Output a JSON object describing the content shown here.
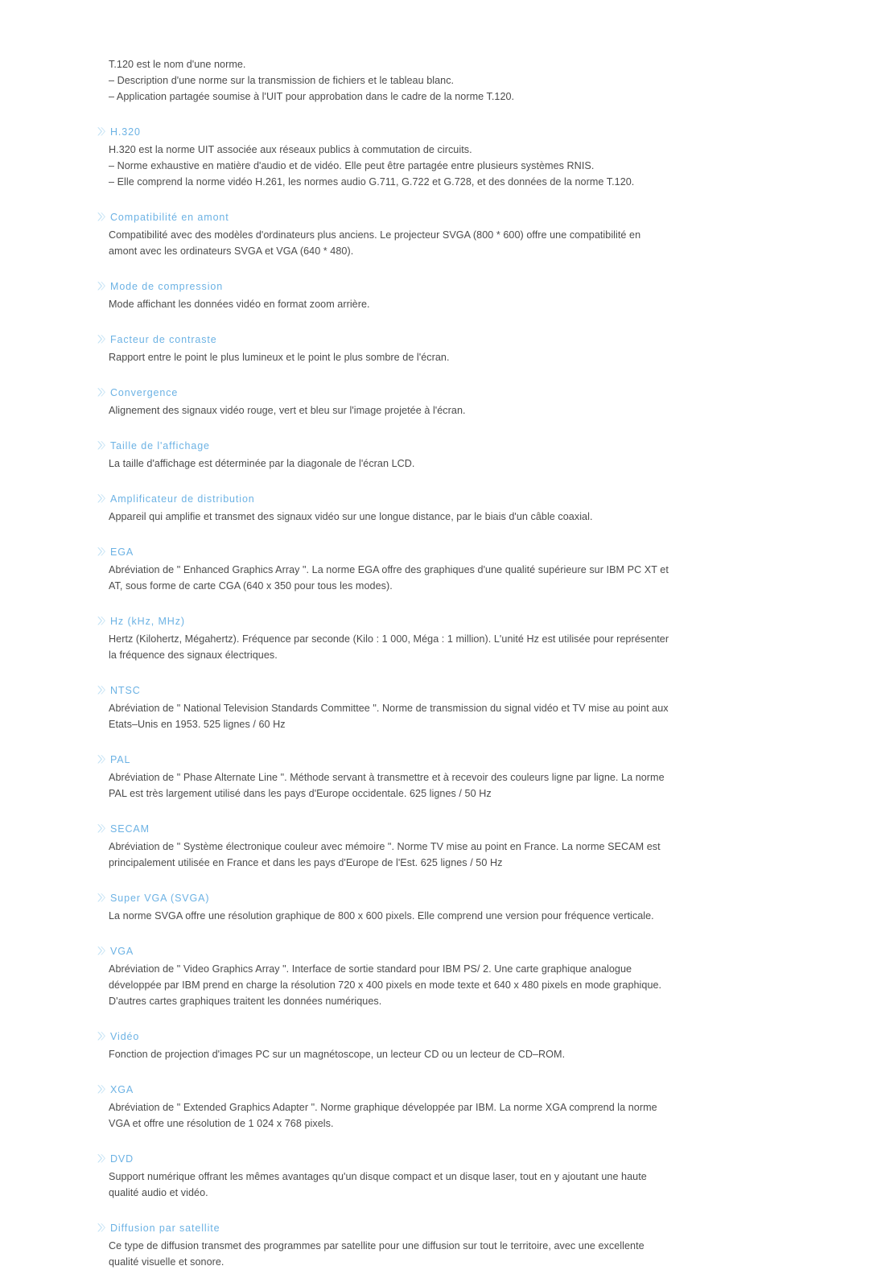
{
  "document": {
    "language": "fr",
    "background_color": "#ffffff",
    "heading_color": "#6cb2e4",
    "body_color": "#4b4b4b",
    "marker_color": "#bddff3",
    "marker_icon": "double-chevron-right-icon"
  },
  "intro": {
    "lines": [
      "T.120 est le nom d'une norme.",
      "– Description d'une norme sur la transmission de fichiers et le tableau blanc.",
      "– Application partagée soumise à l'UIT pour approbation dans le cadre de la norme T.120."
    ]
  },
  "sections": [
    {
      "heading": "H.320",
      "lines": [
        "H.320 est la norme UIT associée aux réseaux publics à commutation de circuits.",
        "– Norme exhaustive en matière d'audio et de vidéo. Elle peut être partagée entre plusieurs systèmes RNIS.",
        "– Elle comprend la norme vidéo H.261, les normes audio G.711, G.722 et G.728, et des données de la norme T.120."
      ]
    },
    {
      "heading": "Compatibilité en amont",
      "lines": [
        "Compatibilité avec des modèles d'ordinateurs plus anciens. Le projecteur SVGA (800 * 600) offre une compatibilité en amont avec les ordinateurs SVGA et VGA (640 * 480)."
      ]
    },
    {
      "heading": "Mode de compression",
      "lines": [
        "Mode affichant les données vidéo en format zoom arrière."
      ]
    },
    {
      "heading": "Facteur de contraste",
      "lines": [
        "Rapport entre le point le plus lumineux et le point le plus sombre de l'écran."
      ]
    },
    {
      "heading": "Convergence",
      "lines": [
        "Alignement des signaux vidéo rouge, vert et bleu sur l'image projetée à l'écran."
      ]
    },
    {
      "heading": "Taille de l'affichage",
      "lines": [
        "La taille d'affichage est déterminée par la diagonale de l'écran LCD."
      ]
    },
    {
      "heading": "Amplificateur de distribution",
      "lines": [
        "Appareil qui amplifie et transmet des signaux vidéo sur une longue distance, par le biais d'un câble coaxial."
      ]
    },
    {
      "heading": "EGA",
      "lines": [
        "Abréviation de \" Enhanced Graphics Array \". La norme EGA offre des graphiques d'une qualité supérieure sur IBM PC XT et AT, sous forme de carte CGA (640 x 350 pour tous les modes)."
      ]
    },
    {
      "heading": "Hz (kHz, MHz)",
      "lines": [
        "Hertz (Kilohertz, Mégahertz). Fréquence par seconde (Kilo : 1 000, Méga : 1 million). L'unité Hz est utilisée pour représenter la fréquence des signaux électriques."
      ]
    },
    {
      "heading": "NTSC",
      "lines": [
        "Abréviation de \" National Television Standards Committee \". Norme de transmission du signal vidéo et TV mise au point aux Etats–Unis en 1953. 525 lignes / 60 Hz"
      ]
    },
    {
      "heading": "PAL",
      "lines": [
        "Abréviation de \" Phase Alternate Line \". Méthode servant à transmettre et à recevoir des couleurs ligne par ligne. La norme PAL est très largement utilisé dans les pays d'Europe occidentale. 625 lignes / 50 Hz"
      ]
    },
    {
      "heading": "SECAM",
      "lines": [
        "Abréviation de \" Système électronique couleur avec mémoire \". Norme TV mise au point en France. La norme SECAM est principalement utilisée en France et dans les pays d'Europe de l'Est. 625 lignes / 50 Hz"
      ]
    },
    {
      "heading": "Super VGA (SVGA)",
      "lines": [
        "La norme SVGA offre une résolution graphique de 800 x 600 pixels. Elle comprend une version pour fréquence verticale."
      ]
    },
    {
      "heading": "VGA",
      "lines": [
        "Abréviation de \" Video Graphics Array \". Interface de sortie standard pour IBM PS/ 2. Une carte graphique analogue développée par IBM prend en charge la résolution 720 x 400 pixels en mode texte et 640 x 480 pixels en mode graphique. D'autres cartes graphiques traitent les données numériques."
      ]
    },
    {
      "heading": "Vidéo",
      "lines": [
        "Fonction de projection d'images PC sur un magnétoscope, un lecteur CD ou un lecteur de CD–ROM."
      ]
    },
    {
      "heading": "XGA",
      "lines": [
        "Abréviation de \" Extended Graphics Adapter \". Norme graphique développée par IBM. La norme XGA comprend la norme VGA et offre une résolution de 1 024 x 768 pixels."
      ]
    },
    {
      "heading": "DVD",
      "lines": [
        "Support numérique offrant les mêmes avantages qu'un disque compact et un disque laser, tout en y ajoutant une haute qualité audio et vidéo."
      ]
    },
    {
      "heading": "Diffusion par satellite",
      "lines": [
        "Ce type de diffusion transmet des programmes par satellite pour une diffusion sur tout le territoire, avec une excellente qualité visuelle et sonore."
      ]
    }
  ]
}
